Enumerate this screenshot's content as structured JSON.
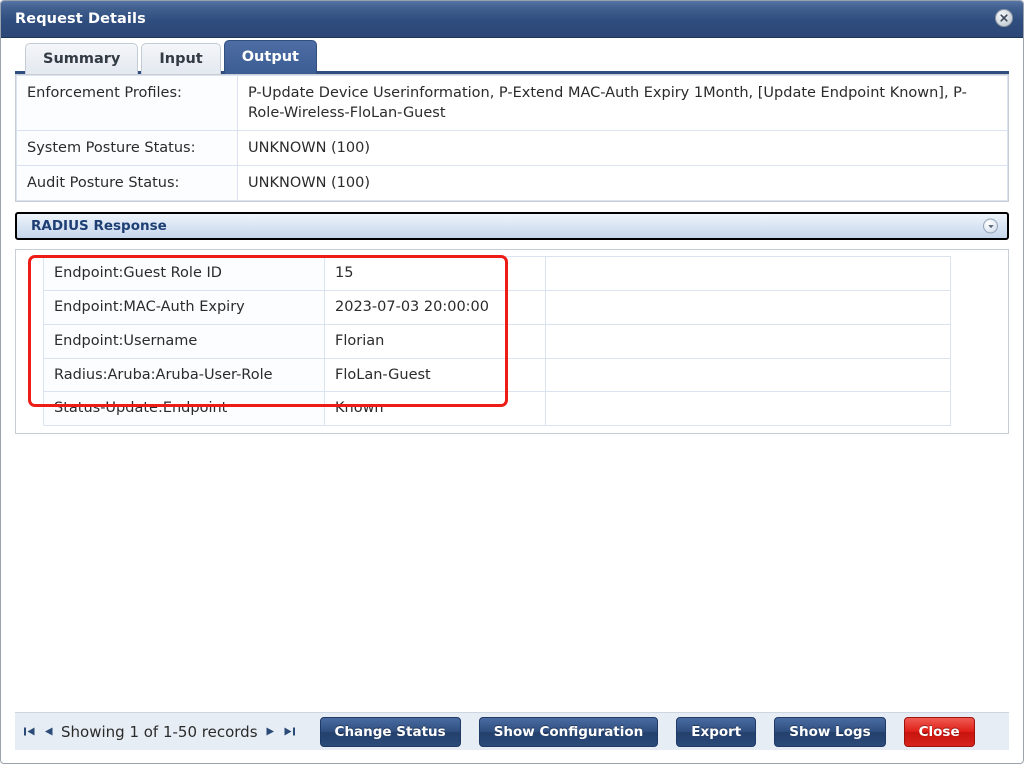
{
  "window": {
    "title": "Request Details",
    "close_icon": "close-circle-icon"
  },
  "tabs": [
    {
      "label": "Summary",
      "active": false
    },
    {
      "label": "Input",
      "active": false
    },
    {
      "label": "Output",
      "active": true
    }
  ],
  "output": {
    "rows": [
      {
        "key": "Enforcement Profiles:",
        "value": "P-Update Device Userinformation, P-Extend MAC-Auth Expiry 1Month, [Update Endpoint Known], P-Role-Wireless-FloLan-Guest"
      },
      {
        "key": "System Posture Status:",
        "value": "UNKNOWN (100)"
      },
      {
        "key": "Audit Posture Status:",
        "value": "UNKNOWN (100)"
      }
    ],
    "section": {
      "title": "RADIUS Response",
      "collapse_icon": "collapse-circle-down-icon"
    },
    "response_rows": [
      {
        "key": "Endpoint:Guest Role ID",
        "value": "15"
      },
      {
        "key": "Endpoint:MAC-Auth Expiry",
        "value": "2023-07-03 20:00:00"
      },
      {
        "key": "Endpoint:Username",
        "value": "Florian"
      },
      {
        "key": "Radius:Aruba:Aruba-User-Role",
        "value": "FloLan-Guest"
      },
      {
        "key": "Status-Update:Endpoint",
        "value": "Known"
      }
    ],
    "highlight_color": "#ee1c17"
  },
  "footer": {
    "pager": {
      "first_icon": "first-page-icon",
      "prev_icon": "previous-page-icon",
      "text": "Showing 1 of 1-50 records",
      "next_icon": "next-page-icon",
      "last_icon": "last-page-icon"
    },
    "buttons": [
      {
        "label": "Change Status",
        "style": "primary"
      },
      {
        "label": "Show Configuration",
        "style": "primary"
      },
      {
        "label": "Export",
        "style": "primary"
      },
      {
        "label": "Show Logs",
        "style": "primary"
      },
      {
        "label": "Close",
        "style": "danger"
      }
    ]
  },
  "colors": {
    "titlebar": "#2f4d7e",
    "active_tab": "#3c5d94",
    "footer_bg": "#e7edf4",
    "highlight": "#ee1c17",
    "danger_button": "#d6241d"
  }
}
